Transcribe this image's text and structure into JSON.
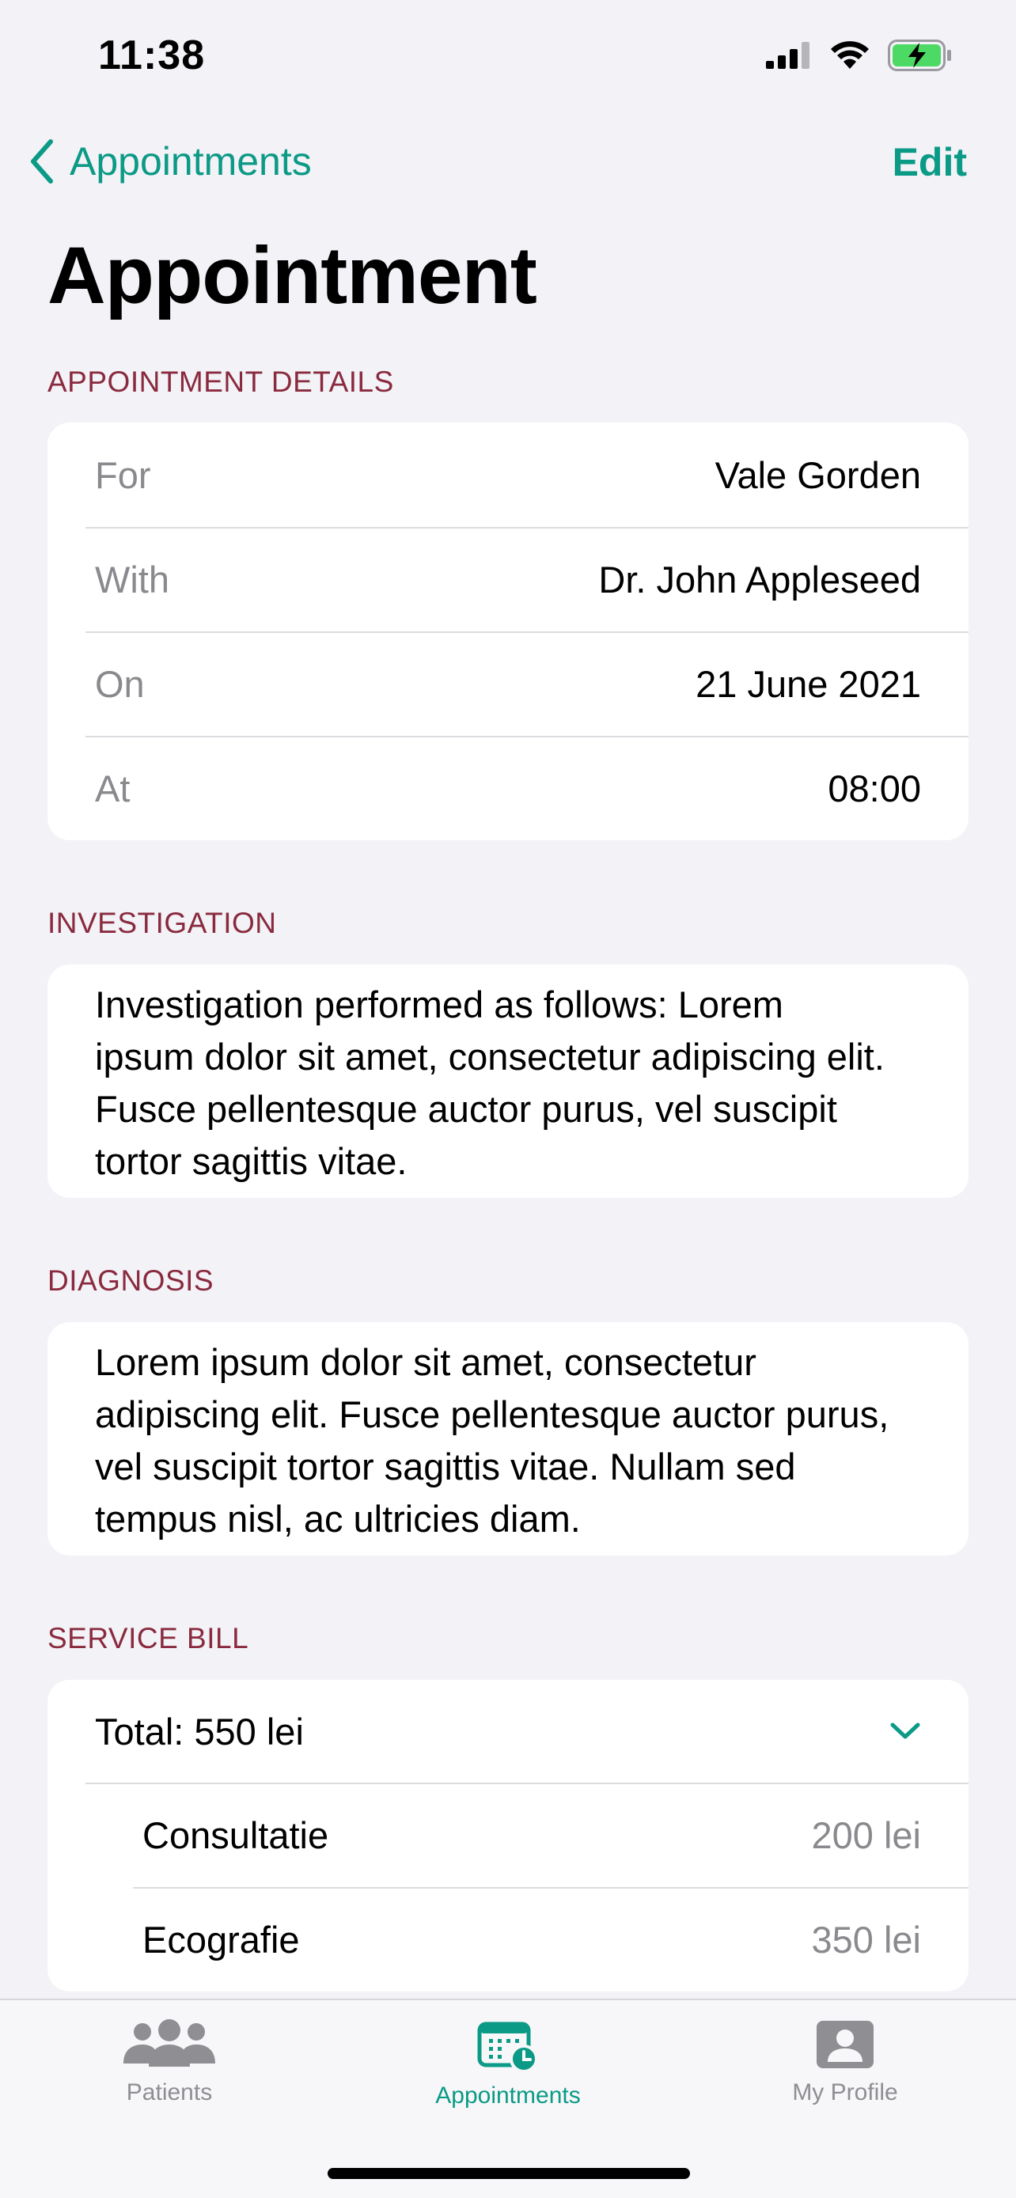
{
  "status_bar": {
    "time": "11:38"
  },
  "nav": {
    "back_label": "Appointments",
    "edit_label": "Edit"
  },
  "title": "Appointment",
  "details": {
    "header": "APPOINTMENT DETAILS",
    "rows": [
      {
        "label": "For",
        "value": "Vale Gorden"
      },
      {
        "label": "With",
        "value": "Dr. John Appleseed"
      },
      {
        "label": "On",
        "value": "21 June 2021"
      },
      {
        "label": "At",
        "value": "08:00"
      }
    ]
  },
  "investigation": {
    "header": "INVESTIGATION",
    "text": "Investigation performed as follows: Lorem ipsum dolor sit amet, consectetur adipiscing elit. Fusce pellentesque auctor purus, vel suscipit tortor sagittis vitae."
  },
  "diagnosis": {
    "header": "DIAGNOSIS",
    "text": "Lorem ipsum dolor sit amet, consectetur adipiscing elit. Fusce pellentesque auctor purus, vel suscipit tortor sagittis vitae. Nullam sed tempus nisl, ac ultricies diam."
  },
  "service_bill": {
    "header": "SERVICE BILL",
    "total": "Total: 550 lei",
    "items": [
      {
        "name": "Consultatie",
        "price": "200 lei"
      },
      {
        "name": "Ecografie",
        "price": "350 lei"
      }
    ]
  },
  "tab_bar": {
    "tabs": [
      {
        "label": "Patients",
        "icon": "people-icon",
        "active": false
      },
      {
        "label": "Appointments",
        "icon": "calendar-clock-icon",
        "active": true
      },
      {
        "label": "My Profile",
        "icon": "person-card-icon",
        "active": false
      }
    ]
  },
  "colors": {
    "accent": "#0b9a86",
    "section_header": "#8a2a3e",
    "background": "#f2f2f7"
  }
}
